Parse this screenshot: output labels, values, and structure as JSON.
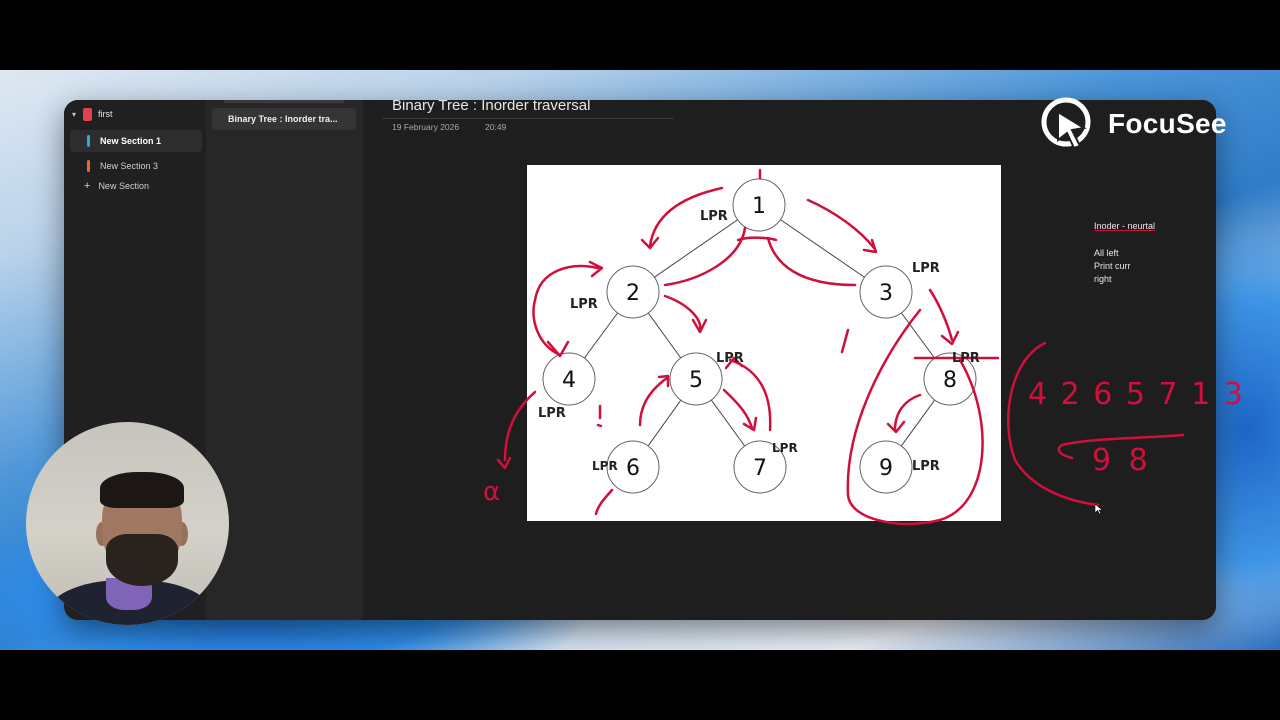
{
  "app": {
    "notebook_name": "first",
    "sections": [
      {
        "label": "New Section 1",
        "color": "#29a9e0",
        "active": true
      },
      {
        "label": "New Section 3",
        "color": "#e86a2c",
        "active": false
      }
    ],
    "add_section_label": "New Section",
    "pages": [
      {
        "label": "Binary Tree : Inorder tra...",
        "active": true
      }
    ]
  },
  "page": {
    "title": "Binary Tree : Inorder traversal",
    "date": "19 February 2026",
    "time": "20:49"
  },
  "tree": {
    "nodes": [
      "1",
      "2",
      "3",
      "4",
      "5",
      "6",
      "7",
      "8",
      "9"
    ]
  },
  "annotations": {
    "lpr_label": "LPR",
    "alpha_symbol": "α",
    "sequence_line1": "4 2 6 5 7 1 3",
    "sequence_line2": "9 8",
    "ink_color": "#d0103a"
  },
  "notes": {
    "heading": "Inoder - neurtal",
    "lines": [
      "All left",
      "Print curr",
      "right"
    ]
  },
  "branding": {
    "logo_text": "FocuSee"
  }
}
